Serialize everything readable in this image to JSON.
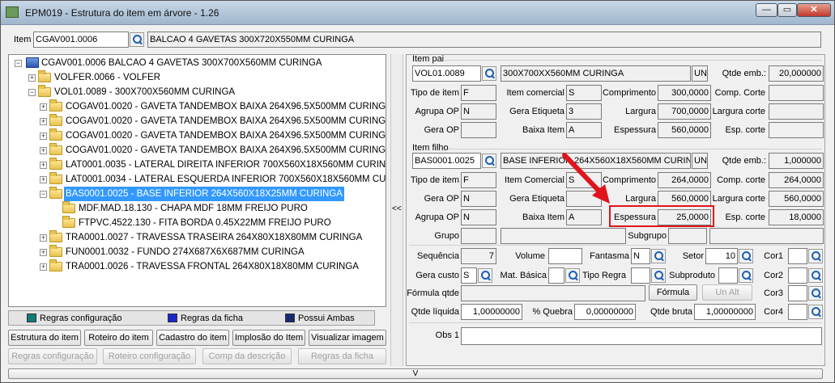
{
  "window": {
    "title": "EPM019 - Estrutura do item em árvore - 1.26"
  },
  "item_bar": {
    "label": "Item",
    "code": "CGAV001.0006",
    "description": "BALCAO 4 GAVETAS 300X720X550MM CURINGA"
  },
  "tree": [
    {
      "text": "CGAV001.0006   BALCAO 4 GAVETAS 300X700X560MM CURINGA"
    },
    {
      "text": "VOLFER.0066 - VOLFER"
    },
    {
      "text": "VOL01.0089 - 300X700X560MM CURINGA"
    },
    {
      "text": "COGAV01.0020 - GAVETA TANDEMBOX BAIXA 264X96.5X500MM CURINGA"
    },
    {
      "text": "COGAV01.0020 - GAVETA TANDEMBOX BAIXA 264X96.5X500MM CURINGA"
    },
    {
      "text": "COGAV01.0020 - GAVETA TANDEMBOX BAIXA 264X96.5X500MM CURINGA"
    },
    {
      "text": "COGAV01.0020 - GAVETA TANDEMBOX BAIXA 264X96.5X500MM CURINGA"
    },
    {
      "text": "LAT0001.0035 - LATERAL DIREITA INFERIOR 700X560X18X560MM CURIN"
    },
    {
      "text": "LAT0001.0034 - LATERAL ESQUERDA INFERIOR 700X560X18X560MM CURIN"
    },
    {
      "text": "BAS0001.0025 - BASE INFERIOR 264X560X18X25MM CURINGA"
    },
    {
      "text": "MDF.MAD.18.130 - CHAPA MDF 18MM FREIJO PURO"
    },
    {
      "text": "FTPVC.4522.130 - FITA BORDA 0.45X22MM FREIJO PURO"
    },
    {
      "text": "TRA0001.0027 - TRAVESSA TRASEIRA 264X80X18X80MM CURINGA"
    },
    {
      "text": "FUN0001.0032 - FUNDO 274X687X6X687MM CURINGA"
    },
    {
      "text": "TRA0001.0026 - TRAVESSA FRONTAL 264X80X18X80MM CURINGA"
    }
  ],
  "legend": {
    "regras_config": "Regras configuração",
    "regras_ficha": "Regras da ficha",
    "possui_ambas": "Possui Ambas"
  },
  "buttons": {
    "estrutura": "Estrutura do item",
    "roteiro": "Roteiro do item",
    "cadastro": "Cadastro do item",
    "implosao": "Implosão do Item",
    "visualizar": "Visualizar imagem",
    "regras_config": "Regras configuração",
    "roteiro_config": "Roteiro configuração",
    "comp_descricao": "Comp da descrição",
    "regras_ficha": "Regras da ficha",
    "formula": "Fórmula",
    "un_alt": "Un Alt",
    "collapse": "<<",
    "expand_down": "V"
  },
  "item_pai": {
    "header": "Item pai",
    "code": "VOL01.0089",
    "description": "300X700XX560MM CURINGA",
    "unit": "UN",
    "qtde_emb_label": "Qtde emb.:",
    "qtde_emb": "20,000000",
    "tipo_item_label": "Tipo de item",
    "tipo_item": "F",
    "item_comercial_label": "Item comercial",
    "item_comercial": "S",
    "comprimento_label": "Comprimento",
    "comprimento": "300,0000",
    "comp_corte_label": "Comp. Corte",
    "comp_corte": "",
    "agrupa_op_label": "Agrupa OP",
    "agrupa_op": "N",
    "gera_etiqueta_label": "Gera Etiqueta",
    "gera_etiqueta": "3",
    "largura_label": "Largura",
    "largura": "700,0000",
    "largura_corte_label": "Largura corte",
    "largura_corte": "",
    "gera_op_label": "Gera OP",
    "gera_op": "",
    "baixa_item_label": "Baixa Item",
    "baixa_item": "A",
    "espessura_label": "Espessura",
    "espessura": "560,0000",
    "esp_corte_label": "Esp. corte",
    "esp_corte": ""
  },
  "item_filho": {
    "header": "Item filho",
    "code": "BAS0001.0025",
    "description": "BASE INFERIOR 264X560X18X560MM CURIN",
    "unit": "UN",
    "qtde_emb_label": "Qtde emb.:",
    "qtde_emb": "1,000000",
    "tipo_item_label": "Tipo de item",
    "tipo_item": "F",
    "item_comercial_label": "Item Comercial",
    "item_comercial": "S",
    "comprimento_label": "Comprimento",
    "comprimento": "264,0000",
    "comp_corte_label": "Comp. corte",
    "comp_corte": "264,0000",
    "gera_op_label": "Gera OP",
    "gera_op": "N",
    "gera_etiqueta_label": "Gera Etiqueta",
    "gera_etiqueta": "",
    "largura_label": "Largura",
    "largura": "560,0000",
    "largura_corte_label": "Largura corte",
    "largura_corte": "560,0000",
    "agrupa_op_label": "Agrupa OP",
    "agrupa_op": "N",
    "baixa_item_label": "Baixa Item",
    "baixa_item": "A",
    "espessura_label": "Espessura",
    "espessura": "25,0000",
    "esp_corte_label": "Esp. corte",
    "esp_corte": "18,0000",
    "grupo_label": "Grupo",
    "grupo": "",
    "subgrupo_label": "Subgrupo",
    "subgrupo": ""
  },
  "structure": {
    "sequencia_label": "Sequência",
    "sequencia": "7",
    "volume_label": "Volume",
    "volume": "",
    "fantasma_label": "Fantasma",
    "fantasma": "N",
    "setor_label": "Setor",
    "setor": "10",
    "cor1_label": "Cor1",
    "cor1": "",
    "gera_custo_label": "Gera custo",
    "gera_custo": "S",
    "mat_basica_label": "Mat. Básica",
    "mat_basica": "",
    "tipo_regra_label": "Tipo Regra",
    "tipo_regra": "",
    "subproduto_label": "Subproduto",
    "subproduto": "",
    "cor2_label": "Cor2",
    "cor2": "",
    "formula_qtde_label": "Fórmula qtde",
    "formula_qtde": "",
    "cor3_label": "Cor3",
    "cor3": "",
    "qtde_liquida_label": "Qtde líquida",
    "qtde_liquida": "1,00000000",
    "quebra_label": "% Quebra",
    "quebra": "0,00000000",
    "qtde_bruta_label": "Qtde bruta",
    "qtde_bruta": "1,00000000",
    "cor4_label": "Cor4",
    "cor4": "",
    "obs1_label": "Obs 1",
    "obs1": ""
  },
  "colors": {
    "selection": "#3399ff",
    "highlight": "#e0141c"
  }
}
